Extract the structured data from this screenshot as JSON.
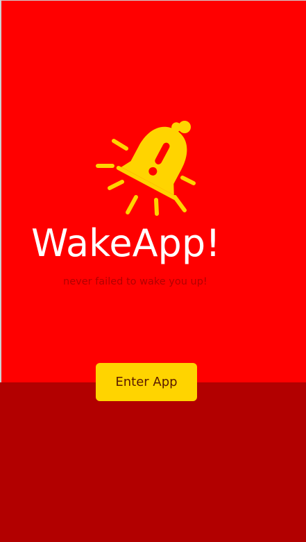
{
  "app": {
    "title": "WakeApp!",
    "tagline": "never failed to wake you up!"
  },
  "actions": {
    "enter_label": "Enter App"
  },
  "logo": {
    "icon": "alarm-bell-icon"
  },
  "colors": {
    "background": "#ff0000",
    "bottom_panel": "#b20000",
    "accent": "#ffd400",
    "button_text": "#5a1a00",
    "title_text": "#ffffff",
    "tagline_text": "#b20000"
  }
}
